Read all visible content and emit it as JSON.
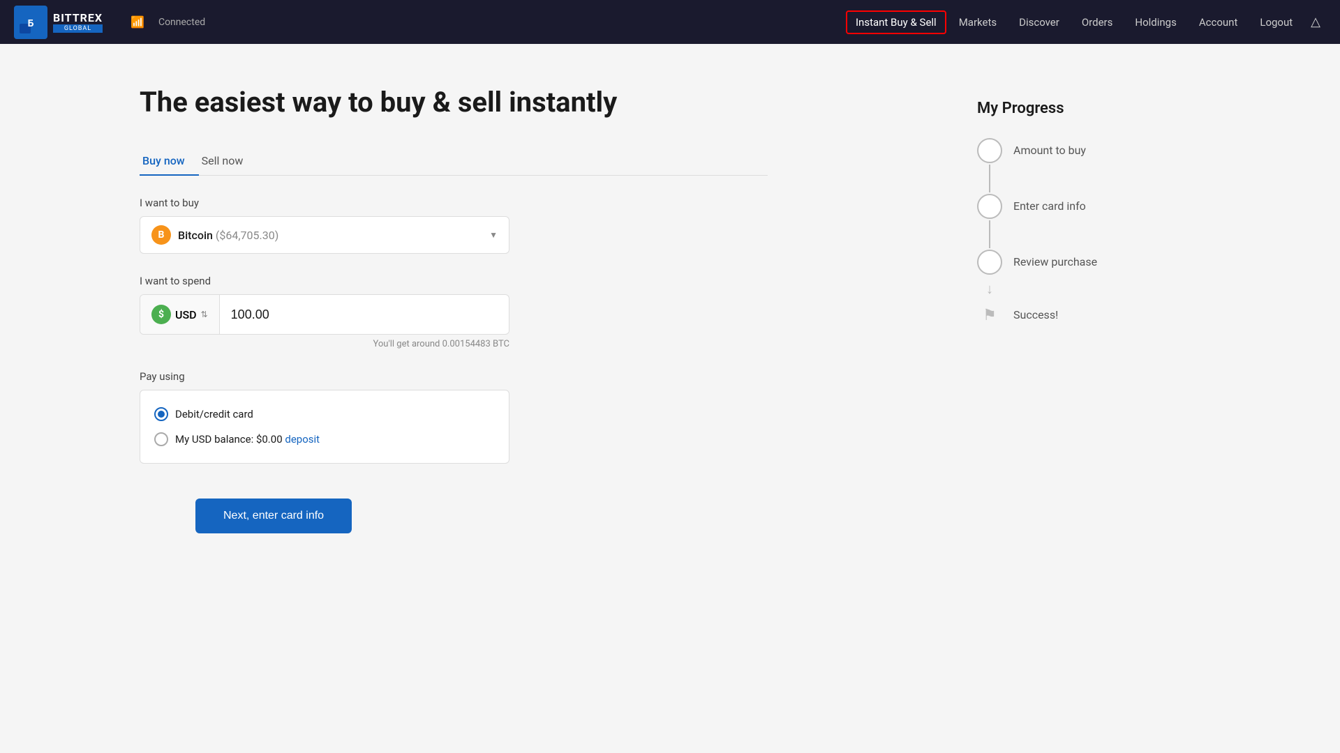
{
  "header": {
    "logo_top": "BITTREX",
    "logo_bottom": "GLOBAL",
    "connection_status": "Connected",
    "nav_items": [
      {
        "label": "Instant Buy & Sell",
        "active": true
      },
      {
        "label": "Markets",
        "active": false
      },
      {
        "label": "Discover",
        "active": false
      },
      {
        "label": "Orders",
        "active": false
      },
      {
        "label": "Holdings",
        "active": false
      },
      {
        "label": "Account",
        "active": false
      },
      {
        "label": "Logout",
        "active": false
      }
    ]
  },
  "main": {
    "page_title": "The easiest way to buy & sell instantly",
    "tabs": [
      {
        "label": "Buy now",
        "active": true
      },
      {
        "label": "Sell now",
        "active": false
      }
    ],
    "want_to_buy_label": "I want to buy",
    "crypto_selector": {
      "name": "Bitcoin",
      "price": "($64,705.30)",
      "symbol": "B"
    },
    "want_to_spend_label": "I want to spend",
    "currency": "USD",
    "amount": "100.00",
    "conversion_hint": "You'll get around 0.00154483 BTC",
    "pay_using_label": "Pay using",
    "pay_options": [
      {
        "label": "Debit/credit card",
        "selected": true
      },
      {
        "label": "My USD balance: $0.00",
        "link": "deposit",
        "selected": false
      }
    ],
    "next_button": "Next, enter card info"
  },
  "progress": {
    "title": "My Progress",
    "steps": [
      {
        "label": "Amount to buy"
      },
      {
        "label": "Enter card info"
      },
      {
        "label": "Review purchase"
      },
      {
        "label": "Success!"
      }
    ]
  }
}
